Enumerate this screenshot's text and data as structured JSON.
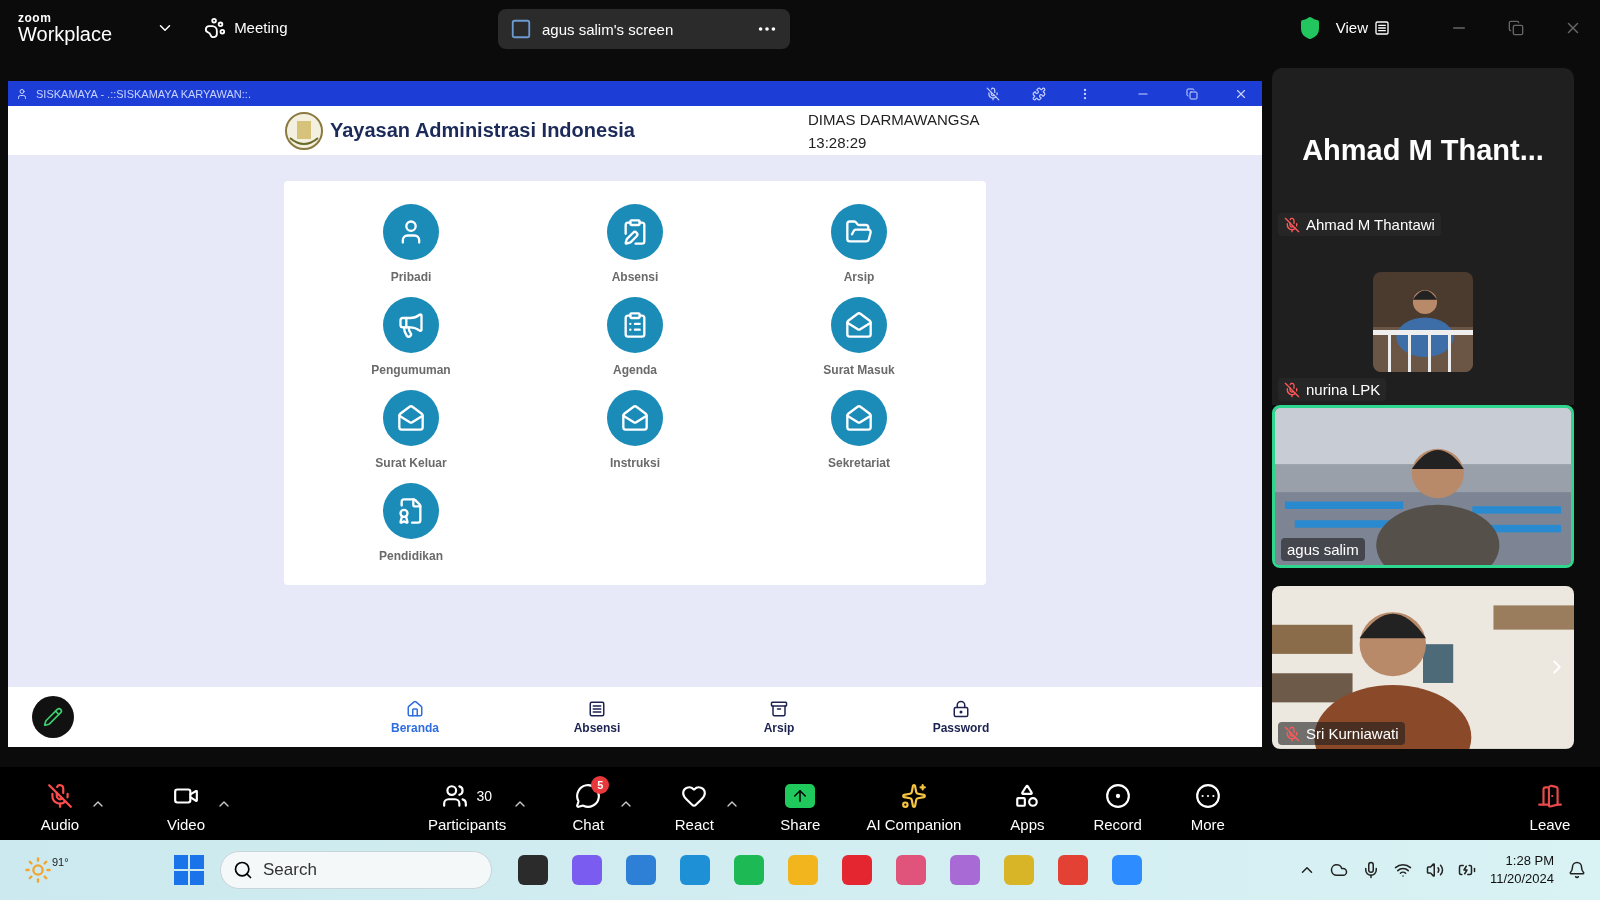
{
  "zoom_bar": {
    "brand_top": "zoom",
    "brand": "Workplace",
    "meeting_label": "Meeting",
    "share_label": "agus salim's screen",
    "view_label": "View"
  },
  "shared_window": {
    "title": "SISKAMAYA - .::SISKAMAYA KARYAWAN::.",
    "org_name": "Yayasan Administrasi Indonesia",
    "user_name": "DIMAS DARMAWANGSA",
    "time": "13:28:29",
    "menu_items": [
      {
        "label": "Pribadi"
      },
      {
        "label": "Absensi"
      },
      {
        "label": "Arsip"
      },
      {
        "label": "Pengumuman"
      },
      {
        "label": "Agenda"
      },
      {
        "label": "Surat Masuk"
      },
      {
        "label": "Surat Keluar"
      },
      {
        "label": "Instruksi"
      },
      {
        "label": "Sekretariat"
      },
      {
        "label": "Pendidikan"
      }
    ],
    "nav": [
      {
        "label": "Beranda",
        "selected": true
      },
      {
        "label": "Absensi",
        "selected": false
      },
      {
        "label": "Arsip",
        "selected": false
      },
      {
        "label": "Password",
        "selected": false
      }
    ]
  },
  "participants": [
    {
      "kind": "name_card",
      "big_name": "Ahmad M Thant...",
      "name": "Ahmad M Thantawi",
      "muted": true,
      "active": false
    },
    {
      "kind": "thumbnail",
      "name": "nurina LPK",
      "muted": true,
      "active": false
    },
    {
      "kind": "video",
      "name": "agus salim",
      "muted": false,
      "active": true
    },
    {
      "kind": "video",
      "name": "Sri Kurniawati",
      "muted": true,
      "active": false
    }
  ],
  "toolbar": [
    {
      "label": "Audio",
      "muted": true,
      "caret": true
    },
    {
      "label": "Video",
      "caret": true
    },
    {
      "label": "Participants",
      "count": "30",
      "caret": true
    },
    {
      "label": "Chat",
      "badge": "5",
      "caret": true
    },
    {
      "label": "React",
      "caret": true
    },
    {
      "label": "Share",
      "caret": false
    },
    {
      "label": "AI Companion",
      "caret": false
    },
    {
      "label": "Apps",
      "caret": false
    },
    {
      "label": "Record",
      "caret": false
    },
    {
      "label": "More",
      "caret": false
    },
    {
      "label": "Leave",
      "caret": false
    }
  ],
  "taskbar": {
    "weather": "91°",
    "search_placeholder": "Search",
    "time": "1:28 PM",
    "date": "11/20/2024"
  }
}
